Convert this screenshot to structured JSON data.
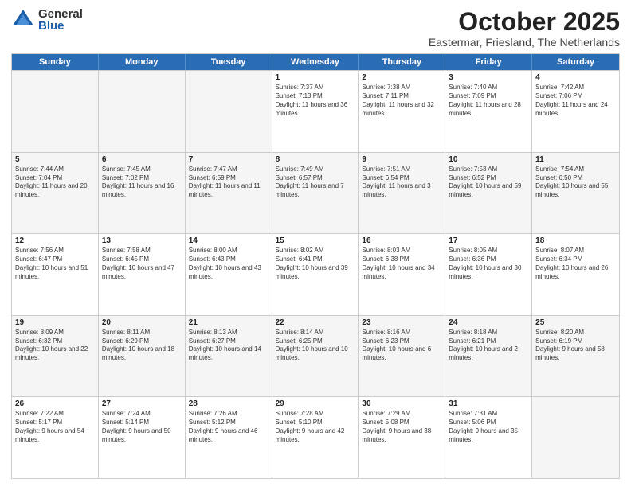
{
  "header": {
    "logo_general": "General",
    "logo_blue": "Blue",
    "month_title": "October 2025",
    "location": "Eastermar, Friesland, The Netherlands"
  },
  "days_of_week": [
    "Sunday",
    "Monday",
    "Tuesday",
    "Wednesday",
    "Thursday",
    "Friday",
    "Saturday"
  ],
  "weeks": [
    [
      {
        "day": "",
        "info": ""
      },
      {
        "day": "",
        "info": ""
      },
      {
        "day": "",
        "info": ""
      },
      {
        "day": "1",
        "info": "Sunrise: 7:37 AM\nSunset: 7:13 PM\nDaylight: 11 hours and 36 minutes."
      },
      {
        "day": "2",
        "info": "Sunrise: 7:38 AM\nSunset: 7:11 PM\nDaylight: 11 hours and 32 minutes."
      },
      {
        "day": "3",
        "info": "Sunrise: 7:40 AM\nSunset: 7:09 PM\nDaylight: 11 hours and 28 minutes."
      },
      {
        "day": "4",
        "info": "Sunrise: 7:42 AM\nSunset: 7:06 PM\nDaylight: 11 hours and 24 minutes."
      }
    ],
    [
      {
        "day": "5",
        "info": "Sunrise: 7:44 AM\nSunset: 7:04 PM\nDaylight: 11 hours and 20 minutes."
      },
      {
        "day": "6",
        "info": "Sunrise: 7:45 AM\nSunset: 7:02 PM\nDaylight: 11 hours and 16 minutes."
      },
      {
        "day": "7",
        "info": "Sunrise: 7:47 AM\nSunset: 6:59 PM\nDaylight: 11 hours and 11 minutes."
      },
      {
        "day": "8",
        "info": "Sunrise: 7:49 AM\nSunset: 6:57 PM\nDaylight: 11 hours and 7 minutes."
      },
      {
        "day": "9",
        "info": "Sunrise: 7:51 AM\nSunset: 6:54 PM\nDaylight: 11 hours and 3 minutes."
      },
      {
        "day": "10",
        "info": "Sunrise: 7:53 AM\nSunset: 6:52 PM\nDaylight: 10 hours and 59 minutes."
      },
      {
        "day": "11",
        "info": "Sunrise: 7:54 AM\nSunset: 6:50 PM\nDaylight: 10 hours and 55 minutes."
      }
    ],
    [
      {
        "day": "12",
        "info": "Sunrise: 7:56 AM\nSunset: 6:47 PM\nDaylight: 10 hours and 51 minutes."
      },
      {
        "day": "13",
        "info": "Sunrise: 7:58 AM\nSunset: 6:45 PM\nDaylight: 10 hours and 47 minutes."
      },
      {
        "day": "14",
        "info": "Sunrise: 8:00 AM\nSunset: 6:43 PM\nDaylight: 10 hours and 43 minutes."
      },
      {
        "day": "15",
        "info": "Sunrise: 8:02 AM\nSunset: 6:41 PM\nDaylight: 10 hours and 39 minutes."
      },
      {
        "day": "16",
        "info": "Sunrise: 8:03 AM\nSunset: 6:38 PM\nDaylight: 10 hours and 34 minutes."
      },
      {
        "day": "17",
        "info": "Sunrise: 8:05 AM\nSunset: 6:36 PM\nDaylight: 10 hours and 30 minutes."
      },
      {
        "day": "18",
        "info": "Sunrise: 8:07 AM\nSunset: 6:34 PM\nDaylight: 10 hours and 26 minutes."
      }
    ],
    [
      {
        "day": "19",
        "info": "Sunrise: 8:09 AM\nSunset: 6:32 PM\nDaylight: 10 hours and 22 minutes."
      },
      {
        "day": "20",
        "info": "Sunrise: 8:11 AM\nSunset: 6:29 PM\nDaylight: 10 hours and 18 minutes."
      },
      {
        "day": "21",
        "info": "Sunrise: 8:13 AM\nSunset: 6:27 PM\nDaylight: 10 hours and 14 minutes."
      },
      {
        "day": "22",
        "info": "Sunrise: 8:14 AM\nSunset: 6:25 PM\nDaylight: 10 hours and 10 minutes."
      },
      {
        "day": "23",
        "info": "Sunrise: 8:16 AM\nSunset: 6:23 PM\nDaylight: 10 hours and 6 minutes."
      },
      {
        "day": "24",
        "info": "Sunrise: 8:18 AM\nSunset: 6:21 PM\nDaylight: 10 hours and 2 minutes."
      },
      {
        "day": "25",
        "info": "Sunrise: 8:20 AM\nSunset: 6:19 PM\nDaylight: 9 hours and 58 minutes."
      }
    ],
    [
      {
        "day": "26",
        "info": "Sunrise: 7:22 AM\nSunset: 5:17 PM\nDaylight: 9 hours and 54 minutes."
      },
      {
        "day": "27",
        "info": "Sunrise: 7:24 AM\nSunset: 5:14 PM\nDaylight: 9 hours and 50 minutes."
      },
      {
        "day": "28",
        "info": "Sunrise: 7:26 AM\nSunset: 5:12 PM\nDaylight: 9 hours and 46 minutes."
      },
      {
        "day": "29",
        "info": "Sunrise: 7:28 AM\nSunset: 5:10 PM\nDaylight: 9 hours and 42 minutes."
      },
      {
        "day": "30",
        "info": "Sunrise: 7:29 AM\nSunset: 5:08 PM\nDaylight: 9 hours and 38 minutes."
      },
      {
        "day": "31",
        "info": "Sunrise: 7:31 AM\nSunset: 5:06 PM\nDaylight: 9 hours and 35 minutes."
      },
      {
        "day": "",
        "info": ""
      }
    ]
  ]
}
